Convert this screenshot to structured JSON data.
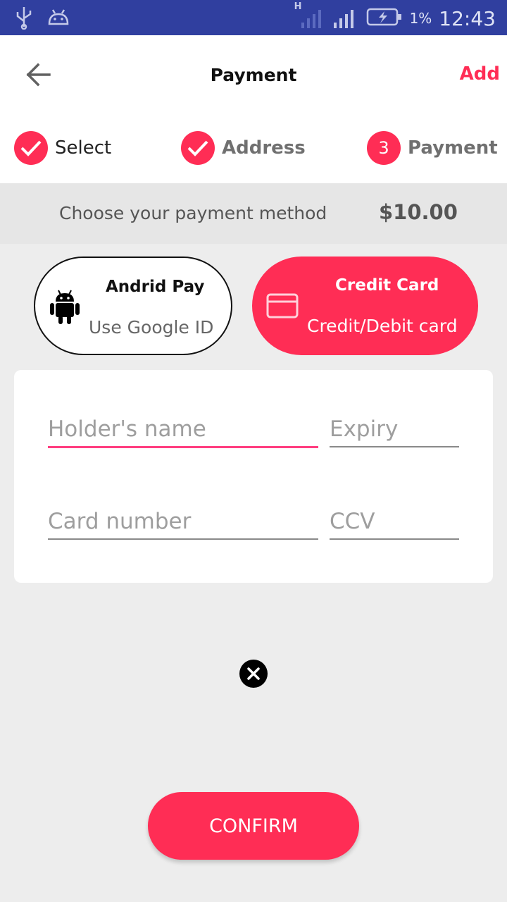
{
  "status_bar": {
    "time": "12:43",
    "battery_percent": "1%",
    "network_label": "H",
    "icons": [
      "usb-icon",
      "android-debug-icon",
      "signal-icon",
      "battery-charging-icon"
    ]
  },
  "header": {
    "title": "Payment",
    "action_label": "Add",
    "back_icon": "arrow-left-icon"
  },
  "steps": [
    {
      "label": "Select",
      "state": "done"
    },
    {
      "label": "Address",
      "state": "done"
    },
    {
      "label": "Payment",
      "number": "3",
      "state": "current"
    }
  ],
  "payment_method": {
    "prompt": "Choose your payment method",
    "amount": "$10.00"
  },
  "options": {
    "android": {
      "title": "Andrid Pay",
      "subtitle": "Use Google ID",
      "icon": "android-icon"
    },
    "card": {
      "title": "Credit Card",
      "subtitle": "Credit/Debit card",
      "icon": "credit-card-icon",
      "selected": true
    }
  },
  "form": {
    "holder_placeholder": "Holder's name",
    "expiry_placeholder": "Expiry",
    "card_number_placeholder": "Card number",
    "ccv_placeholder": "CCV"
  },
  "confirm_label": "CONFIRM",
  "colors": {
    "accent": "#ff2d55",
    "status_bar": "#303f9f",
    "focus_underline": "#ff3d7f"
  }
}
